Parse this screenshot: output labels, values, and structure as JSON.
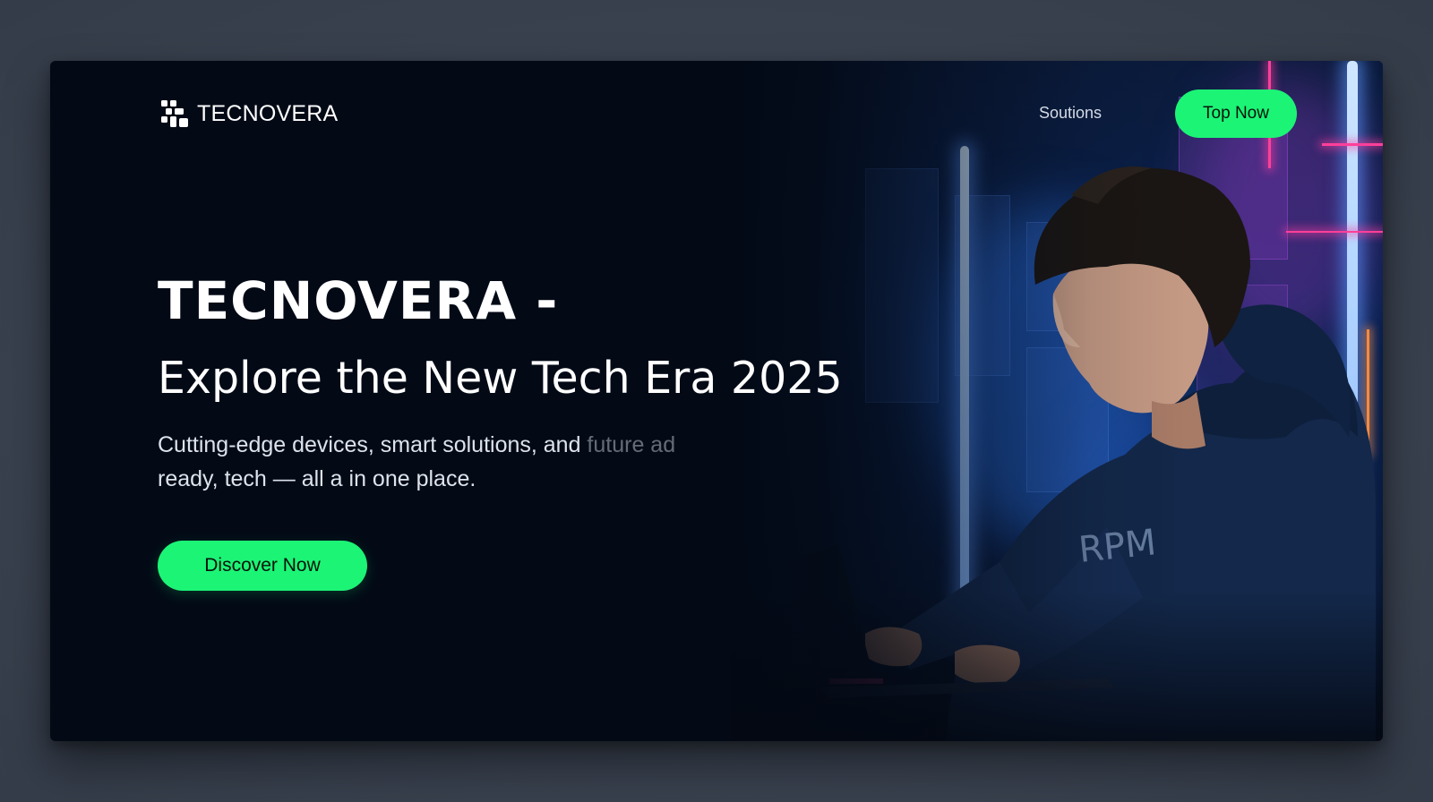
{
  "brand": {
    "name": "TECNOVERA",
    "icon": "tecnovera-logo-icon"
  },
  "nav": {
    "link_label": "Soutions",
    "button_label": "Top Now"
  },
  "hero": {
    "title": "TECNOVERA -",
    "subtitle": "Explore the New Tech Era 2025",
    "description_main": "Cutting-edge devices, smart solutions, and ",
    "description_faded": "future ad",
    "description_line2": "ready, tech — all a in one place.",
    "cta_label": "Discover Now",
    "image": "person-typing-on-laptop-neon-photo"
  },
  "colors": {
    "page_background": "#3a4352",
    "card_background": "#030a16",
    "accent_green": "#1cf476",
    "text_primary": "#ffffff"
  }
}
